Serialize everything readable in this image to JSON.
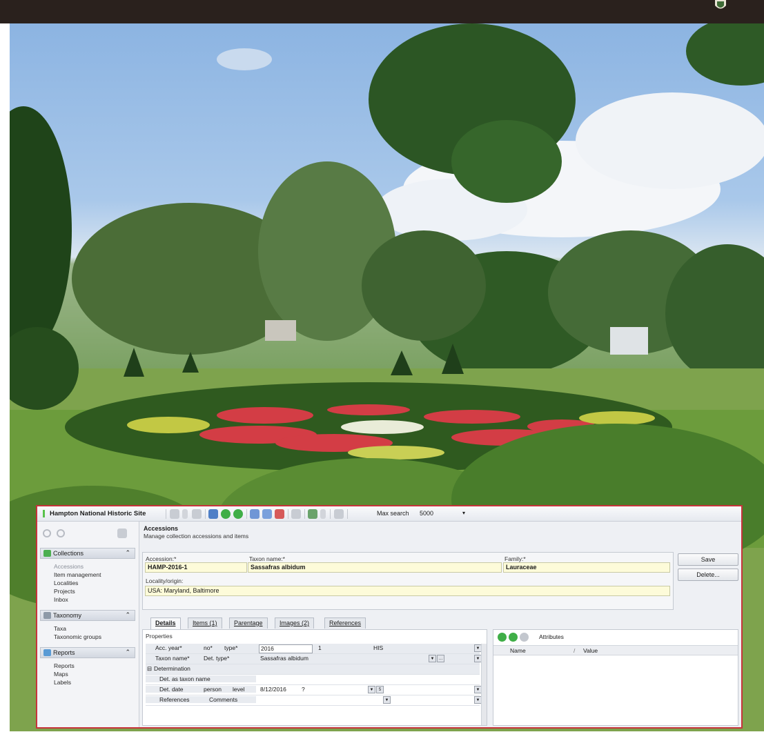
{
  "app": {
    "title": "Hampton National Historic Site",
    "max_search_label": "Max search",
    "max_search_value": "5000",
    "colors": {
      "accent_border": "#c7333b",
      "field_fill": "#fdfbd9",
      "banner": "#2a211d"
    }
  },
  "toolbar_icons": [
    "search-icon",
    "dropdown-arrow-icon",
    "print-icon",
    "form-view-icon",
    "add-record-icon",
    "refresh-icon",
    "window-icon",
    "undo-icon",
    "help-icon",
    "list-icon",
    "user-icon",
    "copy-icon"
  ],
  "nav": {
    "sections": [
      {
        "label": "Collections",
        "icon": "collections-icon",
        "items": [
          "Accessions",
          "Item management",
          "Localities",
          "Projects",
          "Inbox"
        ],
        "active": "Accessions"
      },
      {
        "label": "Taxonomy",
        "icon": "taxonomy-icon",
        "items": [
          "Taxa",
          "Taxonomic groups"
        ]
      },
      {
        "label": "Reports",
        "icon": "reports-icon",
        "items": [
          "Reports",
          "Maps",
          "Labels"
        ]
      }
    ]
  },
  "main": {
    "title": "Accessions",
    "subtitle": "Manage collection accessions and items",
    "accession": {
      "label": "Accession:*",
      "value": "HAMP-2016-1"
    },
    "taxon": {
      "label": "Taxon name:*",
      "value": "Sassafras albidum"
    },
    "family": {
      "label": "Family:*",
      "value": "Lauraceae"
    },
    "locality": {
      "label": "Locality/origin:",
      "value": "USA: Maryland, Baltimore"
    },
    "buttons": {
      "save": "Save",
      "delete": "Delete..."
    },
    "tabs": [
      "Details",
      "Items (1)",
      "Parentage",
      "Images (2)",
      "References"
    ],
    "properties": {
      "heading": "Properties",
      "acc_year_label": "Acc. year*",
      "no_label": "no*",
      "type_label": "type*",
      "acc_year": "2016",
      "acc_no": "1",
      "acc_type": "HIS",
      "taxon_name_label": "Taxon name*",
      "det_type_label": "Det. type*",
      "taxon_name": "Sassafras albidum",
      "determination_label": "Determination",
      "det_as_taxon_label": "Det. as taxon name",
      "det_date_label": "Det. date",
      "person_label": "person",
      "level_label": "level",
      "det_date": "8/12/2016",
      "level_value": "?",
      "references_label": "References",
      "comments_label": "Comments"
    },
    "attributes": {
      "title": "Attributes",
      "col_name": "Name",
      "col_value": "Value"
    }
  }
}
